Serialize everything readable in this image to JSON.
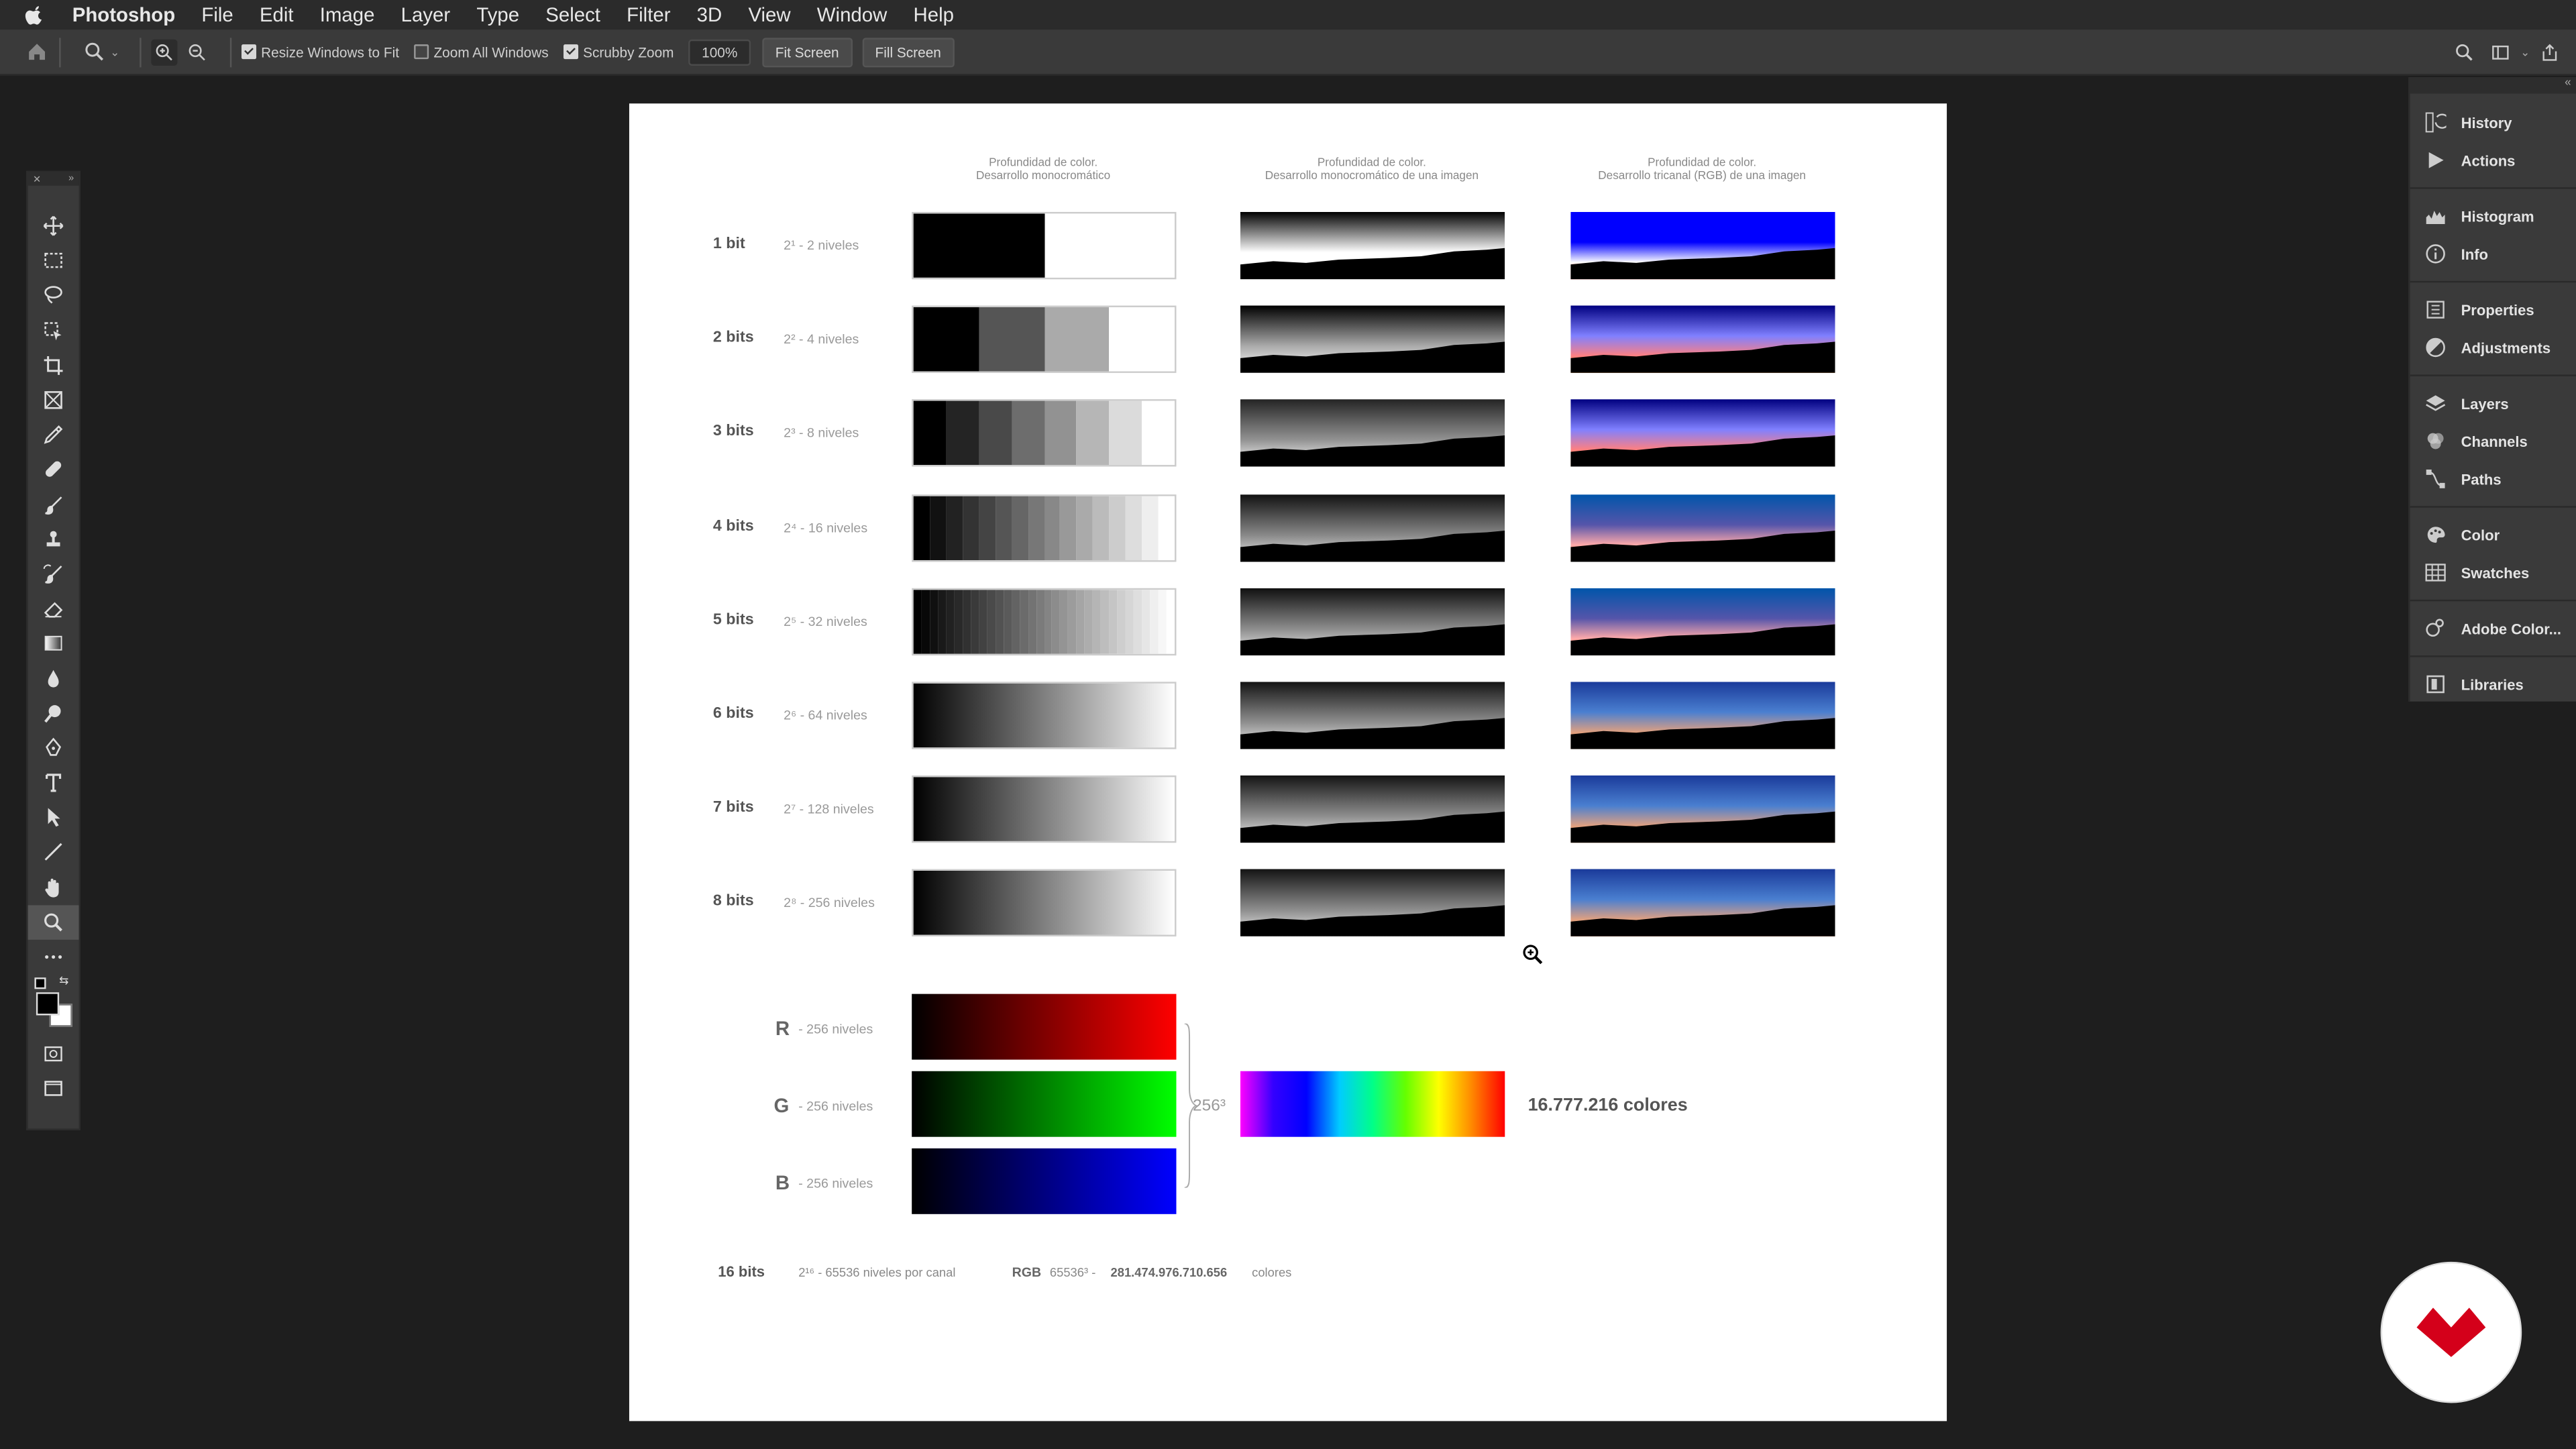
{
  "menubar": {
    "app_name": "Photoshop",
    "items": [
      "File",
      "Edit",
      "Image",
      "Layer",
      "Type",
      "Select",
      "Filter",
      "3D",
      "View",
      "Window",
      "Help"
    ]
  },
  "options_bar": {
    "resize_windows": "Resize Windows to Fit",
    "zoom_all": "Zoom All Windows",
    "scrubby_zoom": "Scrubby Zoom",
    "zoom_value": "100%",
    "fit_screen": "Fit Screen",
    "fill_screen": "Fill Screen"
  },
  "right_panel": {
    "items": [
      "History",
      "Actions",
      "Histogram",
      "Info",
      "Properties",
      "Adjustments",
      "Layers",
      "Channels",
      "Paths",
      "Color",
      "Swatches",
      "Adobe Color...",
      "Libraries"
    ]
  },
  "document": {
    "headers": [
      [
        "Profundidad de color.",
        "Desarrollo monocromático"
      ],
      [
        "Profundidad de color.",
        "Desarrollo monocromático de una imagen"
      ],
      [
        "Profundidad de color.",
        "Desarrollo tricanal (RGB) de una imagen"
      ]
    ],
    "rows": [
      {
        "label": "1 bit",
        "sub": "2¹ - 2 niveles",
        "steps": 2
      },
      {
        "label": "2 bits",
        "sub": "2² - 4 niveles",
        "steps": 4
      },
      {
        "label": "3 bits",
        "sub": "2³ - 8 niveles",
        "steps": 8
      },
      {
        "label": "4 bits",
        "sub": "2⁴ - 16 niveles",
        "steps": 16
      },
      {
        "label": "5 bits",
        "sub": "2⁵ - 32 niveles",
        "steps": 32
      },
      {
        "label": "6 bits",
        "sub": "2⁶ - 64 niveles",
        "steps": 64
      },
      {
        "label": "7 bits",
        "sub": "2⁷ - 128 niveles",
        "steps": 128
      },
      {
        "label": "8 bits",
        "sub": "2⁸ - 256 niveles",
        "steps": 256
      }
    ],
    "rgb": [
      {
        "letter": "R",
        "sub": "- 256 niveles",
        "color": "#ff0000"
      },
      {
        "letter": "G",
        "sub": "- 256 niveles",
        "color": "#00ff00"
      },
      {
        "letter": "B",
        "sub": "- 256 niveles",
        "color": "#0000ff"
      }
    ],
    "power": "256³",
    "total_colors": "16.777.216 colores",
    "footer": {
      "label": "16 bits",
      "per_channel": "2¹⁶ - 65536 niveles por canal",
      "rgb": "RGB",
      "formula": "65536³ -",
      "total": "281.474.976.710.656",
      "suffix": "colores"
    }
  }
}
